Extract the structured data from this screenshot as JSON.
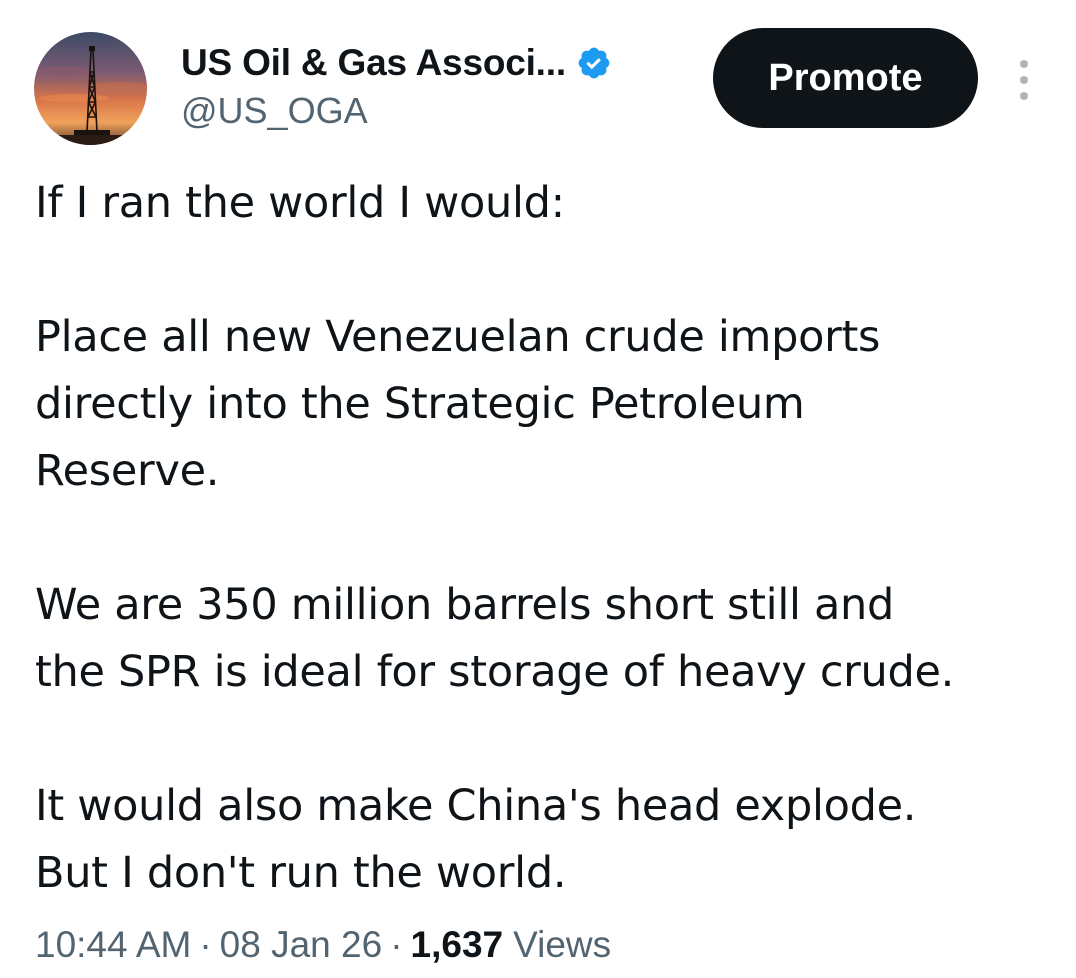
{
  "author": {
    "display_name": "US Oil & Gas Associ...",
    "handle": "@US_OGA",
    "verified": true,
    "avatar_icon": "oil-derrick-sunset-avatar"
  },
  "header": {
    "promote_label": "Promote",
    "more_icon": "vertical-ellipsis-icon"
  },
  "tweet": {
    "lines": {
      "p1_l1": "If I ran the world I would:",
      "p2_l1": "Place all new Venezuelan crude imports",
      "p2_l2": "directly into the Strategic Petroleum",
      "p2_l3": "Reserve.",
      "p3_l1": "We are 350 million barrels short still and",
      "p3_l2": "the SPR is ideal for storage of heavy crude.",
      "p4_l1": "It would also make China's head explode.",
      "p4_l2": "But I don't run the world."
    }
  },
  "meta": {
    "time": "10:44 AM",
    "separator": "·",
    "date": "08 Jan 26",
    "views_count": "1,637",
    "views_label": "Views"
  },
  "colors": {
    "text_primary": "#0f1419",
    "text_secondary": "#536471",
    "verified_blue": "#1d9bf0",
    "button_bg": "#0f1419",
    "button_text": "#ffffff"
  }
}
